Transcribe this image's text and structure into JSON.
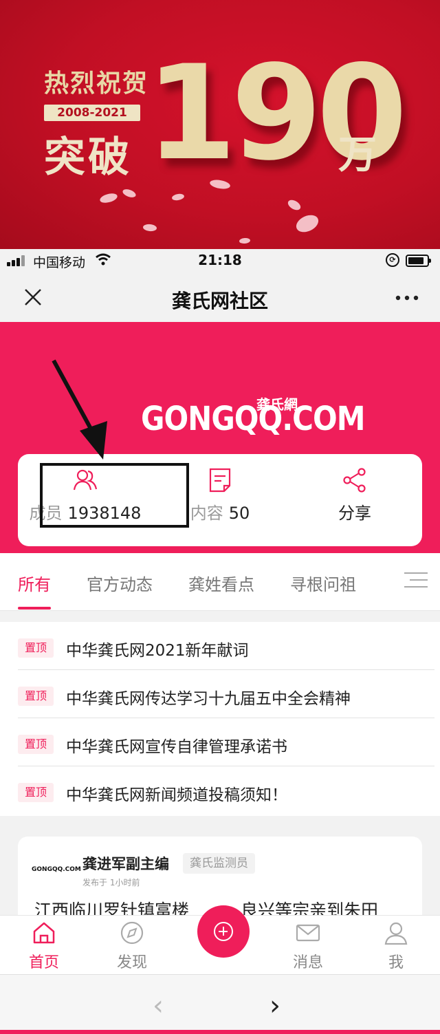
{
  "banner": {
    "congrats": "热烈祝贺",
    "years": "2008-2021",
    "breakthrough": "突破",
    "number": "190",
    "unit": "万"
  },
  "status_bar": {
    "carrier": "中国移动",
    "time": "21:18"
  },
  "navbar": {
    "close_icon": "close-icon",
    "title": "龚氏网社区",
    "more_icon": "more-icon"
  },
  "header": {
    "logo_text": "GONGQQ.COM",
    "logo_subtext": "龚氏網",
    "stats": [
      {
        "label": "成员",
        "value": "1938148",
        "icon": "members-icon"
      },
      {
        "label": "内容",
        "value": "50",
        "icon": "content-icon"
      },
      {
        "label": "分享",
        "value": "",
        "icon": "share-icon"
      }
    ]
  },
  "tabs": [
    {
      "label": "所有",
      "active": true
    },
    {
      "label": "官方动态",
      "active": false
    },
    {
      "label": "龚姓看点",
      "active": false
    },
    {
      "label": "寻根问祖",
      "active": false
    }
  ],
  "pinned": [
    {
      "tag": "置顶",
      "title": "中华龚氏网2021新年献词"
    },
    {
      "tag": "置顶",
      "title": "中华龚氏网传达学习十九届五中全会精神"
    },
    {
      "tag": "置顶",
      "title": "中华龚氏网宣传自律管理承诺书"
    },
    {
      "tag": "置顶",
      "title": "中华龚氏网新闻频道投稿须知！"
    }
  ],
  "post": {
    "avatar_text": "GONGQQ.COM",
    "author": "龚进军副主编",
    "role": "龚氏监测员",
    "time": "发布于 1小时前",
    "title": "江西临川罗针镇富楼　　　良兴等宗亲到朱田"
  },
  "bottom_nav": [
    {
      "label": "首页",
      "icon": "home-icon",
      "active": true
    },
    {
      "label": "发现",
      "icon": "discover-icon",
      "active": false
    },
    {
      "label": "消息",
      "icon": "message-icon",
      "active": false
    },
    {
      "label": "我",
      "icon": "profile-icon",
      "active": false
    }
  ],
  "browser": {
    "back": "‹",
    "forward": "›"
  },
  "colors": {
    "accent": "#ef1e5a",
    "banner_red": "#c10f24",
    "gold": "#ead9a9"
  }
}
